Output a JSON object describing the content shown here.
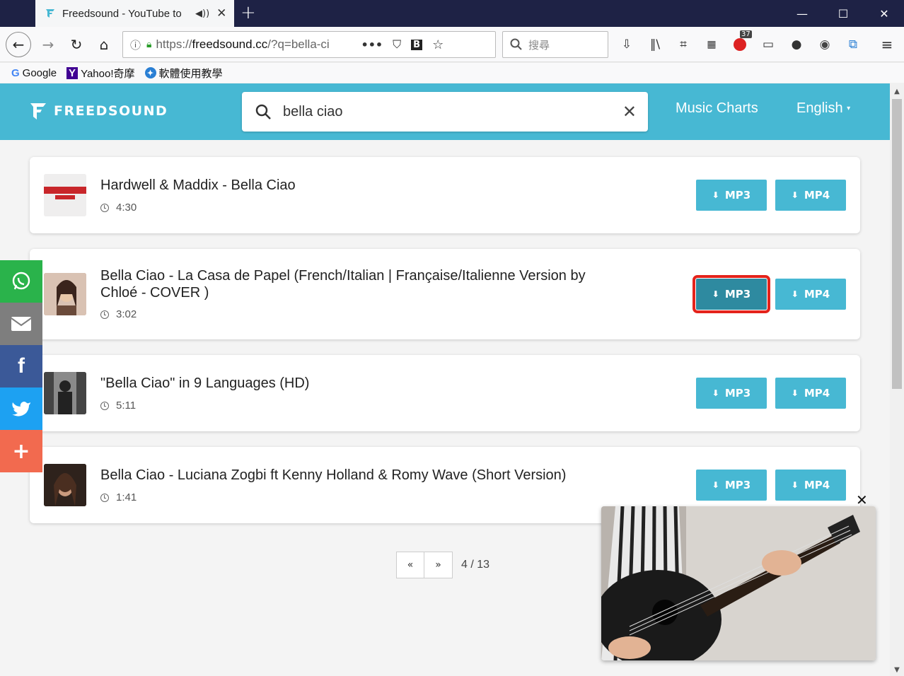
{
  "browser": {
    "tab_title": "Freedsound - YouTube to",
    "url_prefix": "https://",
    "url_host": "freedsound.cc",
    "url_path": "/?q=bella-ci",
    "search_placeholder": "搜尋",
    "addon_badge": "37",
    "bookmarks": [
      "Google",
      "Yahoo!奇摩",
      "軟體使用教學"
    ]
  },
  "site": {
    "logo": "FREEDSOUND",
    "search_value": "bella ciao",
    "nav_charts": "Music Charts",
    "nav_language": "English",
    "colors": {
      "header": "#47b8d3",
      "button": "#47b8d3",
      "highlight": "#e4231b"
    }
  },
  "results": [
    {
      "title": "Hardwell & Maddix - Bella Ciao",
      "duration": "4:30",
      "mp3": "MP3",
      "mp4": "MP4"
    },
    {
      "title": "Bella Ciao - La Casa de Papel (French/Italian | Française/Italienne Version by Chloé - COVER )",
      "duration": "3:02",
      "mp3": "MP3",
      "mp4": "MP4"
    },
    {
      "title": "\"Bella Ciao\" in 9 Languages (HD)",
      "duration": "5:11",
      "mp3": "MP3",
      "mp4": "MP4"
    },
    {
      "title": "Bella Ciao - Luciana Zogbi ft Kenny Holland & Romy Wave (Short Version)",
      "duration": "1:41",
      "mp3": "MP3",
      "mp4": "MP4"
    }
  ],
  "pagination": {
    "prev": "«",
    "next": "»",
    "info": "4 / 13"
  },
  "share_icons": [
    "whatsapp-icon",
    "email-icon",
    "facebook-icon",
    "twitter-icon",
    "plus-icon"
  ]
}
